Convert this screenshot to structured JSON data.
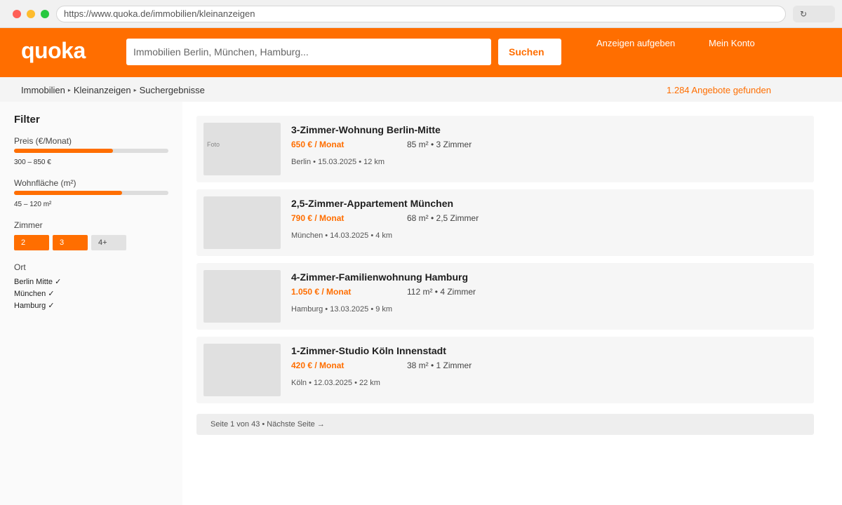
{
  "browser": {
    "url": "https://www.quoka.de/immobilien/kleinanzeigen",
    "reload_label": "↻"
  },
  "header": {
    "logo": "quoka",
    "search_placeholder": "Immobilien Berlin, München, Hamburg...",
    "search_button": "Suchen",
    "nav_post": "Anzeigen aufgeben",
    "nav_account": "Mein Konto"
  },
  "breadcrumb": {
    "items": [
      "Immobilien",
      "Kleinanzeigen",
      "Suchergebnisse"
    ],
    "separator": "▸",
    "result_count": "1.284 Angebote gefunden"
  },
  "filters": {
    "title": "Filter",
    "price": {
      "label": "Preis (€/Monat)",
      "value": "300 – 850 €",
      "fill_fraction": 0.64
    },
    "area": {
      "label": "Wohnfläche (m²)",
      "value": "45 – 120 m²",
      "fill_fraction": 0.7
    },
    "rooms": {
      "label": "Zimmer",
      "options": [
        {
          "label": "2",
          "selected": true
        },
        {
          "label": "3",
          "selected": true
        },
        {
          "label": "4+",
          "selected": false
        }
      ]
    },
    "location": {
      "label": "Ort",
      "items": [
        {
          "label": "Berlin Mitte",
          "check": "✓"
        },
        {
          "label": "München",
          "check": "✓"
        },
        {
          "label": "Hamburg",
          "check": "✓"
        }
      ]
    }
  },
  "listings": [
    {
      "title": "3-Zimmer-Wohnung Berlin-Mitte",
      "price": "650 € / Monat",
      "specs": "85 m² • 3 Zimmer",
      "meta": "Berlin • 15.03.2025 • 12 km",
      "photo_label": "Foto"
    },
    {
      "title": "2,5-Zimmer-Appartement München",
      "price": "790 € / Monat",
      "specs": "68 m² • 2,5 Zimmer",
      "meta": "München • 14.03.2025 • 4 km",
      "photo_label": ""
    },
    {
      "title": "4-Zimmer-Familienwohnung Hamburg",
      "price": "1.050 € / Monat",
      "specs": "112 m² • 4 Zimmer",
      "meta": "Hamburg • 13.03.2025 • 9 km",
      "photo_label": ""
    },
    {
      "title": "1-Zimmer-Studio Köln Innenstadt",
      "price": "420 € / Monat",
      "specs": "38 m² • 1 Zimmer",
      "meta": "Köln • 12.03.2025 • 22 km",
      "photo_label": ""
    }
  ],
  "pagination": {
    "text": "Seite 1 von 43 • Nächste Seite →"
  },
  "colors": {
    "brand": "#ff6e00",
    "card_bg": "#f6f6f6",
    "sidebar_bg": "#fafafa"
  }
}
